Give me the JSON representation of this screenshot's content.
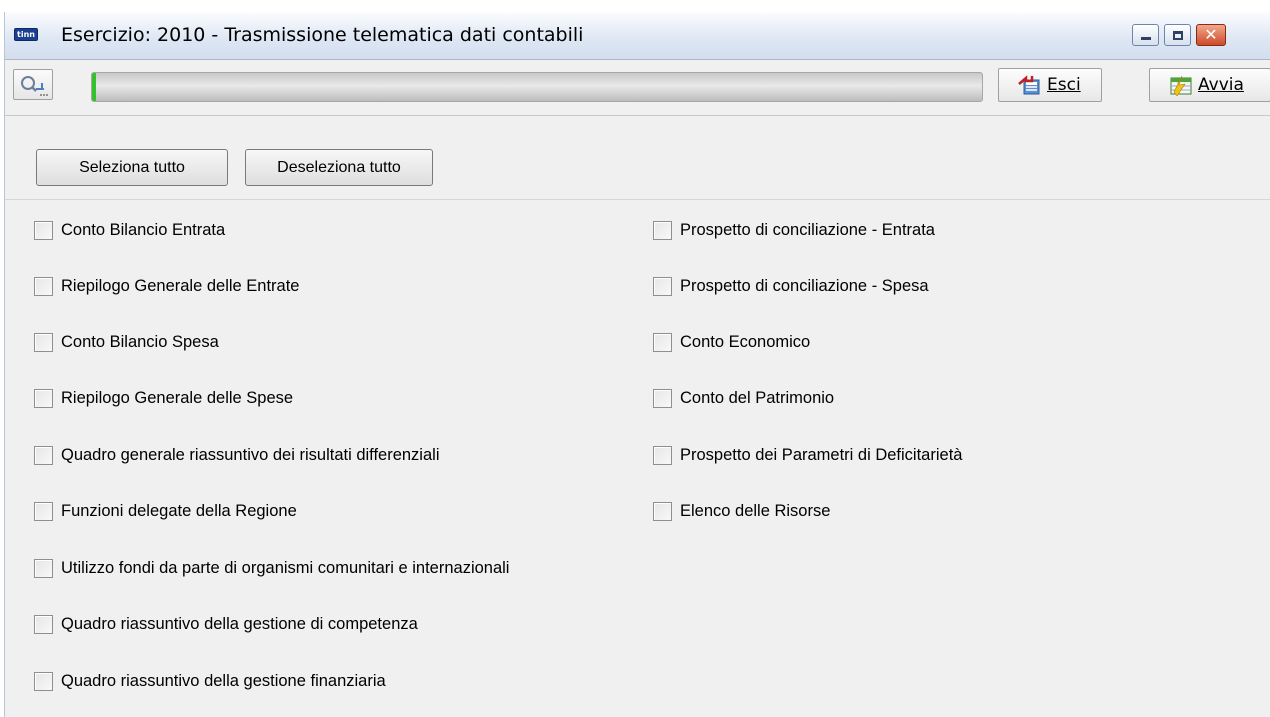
{
  "window": {
    "app_badge": "tinn",
    "title": "Esercizio: 2010 - Trasmissione telematica dati contabili"
  },
  "toolbar": {
    "progress_fraction": 0.005,
    "esci_label": "Esci",
    "avvia_label": "Avvia"
  },
  "selection": {
    "select_all_label": "Seleziona tutto",
    "deselect_all_label": "Deseleziona tutto"
  },
  "reports": {
    "left": [
      "Conto Bilancio Entrata",
      "Riepilogo Generale delle Entrate",
      "Conto Bilancio Spesa",
      "Riepilogo Generale delle Spese",
      "Quadro generale riassuntivo dei risultati differenziali",
      "Funzioni delegate della Regione",
      "Utilizzo fondi da parte di organismi comunitari e internazionali",
      "Quadro riassuntivo della gestione di competenza",
      "Quadro riassuntivo della gestione finanziaria"
    ],
    "right": [
      "Prospetto di conciliazione - Entrata",
      "Prospetto di conciliazione - Spesa",
      "Conto Economico",
      "Conto del Patrimonio",
      "Prospetto dei Parametri di Deficitarietà",
      "Elenco delle Risorse"
    ]
  },
  "colors": {
    "title_bar": "#dde6f3",
    "progress_fill": "#35c12b",
    "close_button": "#cc4a2a"
  }
}
